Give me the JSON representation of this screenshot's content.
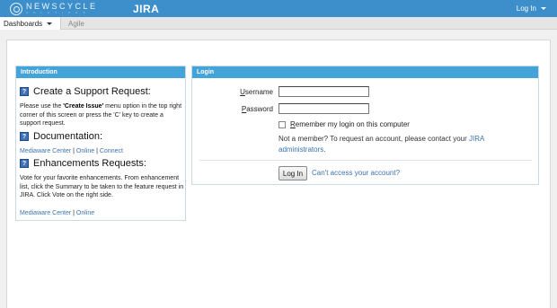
{
  "header": {
    "logo_text": "NEWSCYCLE",
    "logo_sub": "SOLUTIONS",
    "brand": "JIRA",
    "login_label": "Log In"
  },
  "nav": {
    "tabs": [
      {
        "label": "Dashboards"
      },
      {
        "label": "Agile"
      }
    ]
  },
  "intro": {
    "title": "Introduction",
    "support_title": "Create a Support Request:",
    "support_text_1": "Please use the ",
    "support_text_bold": "'Create Issue'",
    "support_text_2": " menu option in the top right corner of this screen or press the 'C' key to create a support request.",
    "doc_title": "Documentation:",
    "doc_links": [
      "Mediaware Center",
      "Online",
      "Connect"
    ],
    "enh_title": "Enhancements Requests:",
    "enh_text": "Vote for your favorite enhancements. From enhancement list, click the Summary to be taken to the feature request in JIRA. Click Vote on the right side.",
    "enh_links": [
      "Mediaware Center",
      "Online"
    ],
    "link_separator": " | "
  },
  "login": {
    "title": "Login",
    "username_label_u": "U",
    "username_label_rest": "sername",
    "password_label_u": "P",
    "password_label_rest": "assword",
    "username_value": "",
    "password_value": "",
    "remember_u": "R",
    "remember_rest": "emember my login on this computer",
    "not_member_text": "Not a member? To request an account, please contact your ",
    "admin_link": "JIRA administrators",
    "not_member_end": ".",
    "submit_label": "Log In",
    "cant_access": "Can't access your account?"
  },
  "colors": {
    "topbar": "#3d8fcc",
    "panel_header": "#44a3d8",
    "link": "#3b73af"
  }
}
